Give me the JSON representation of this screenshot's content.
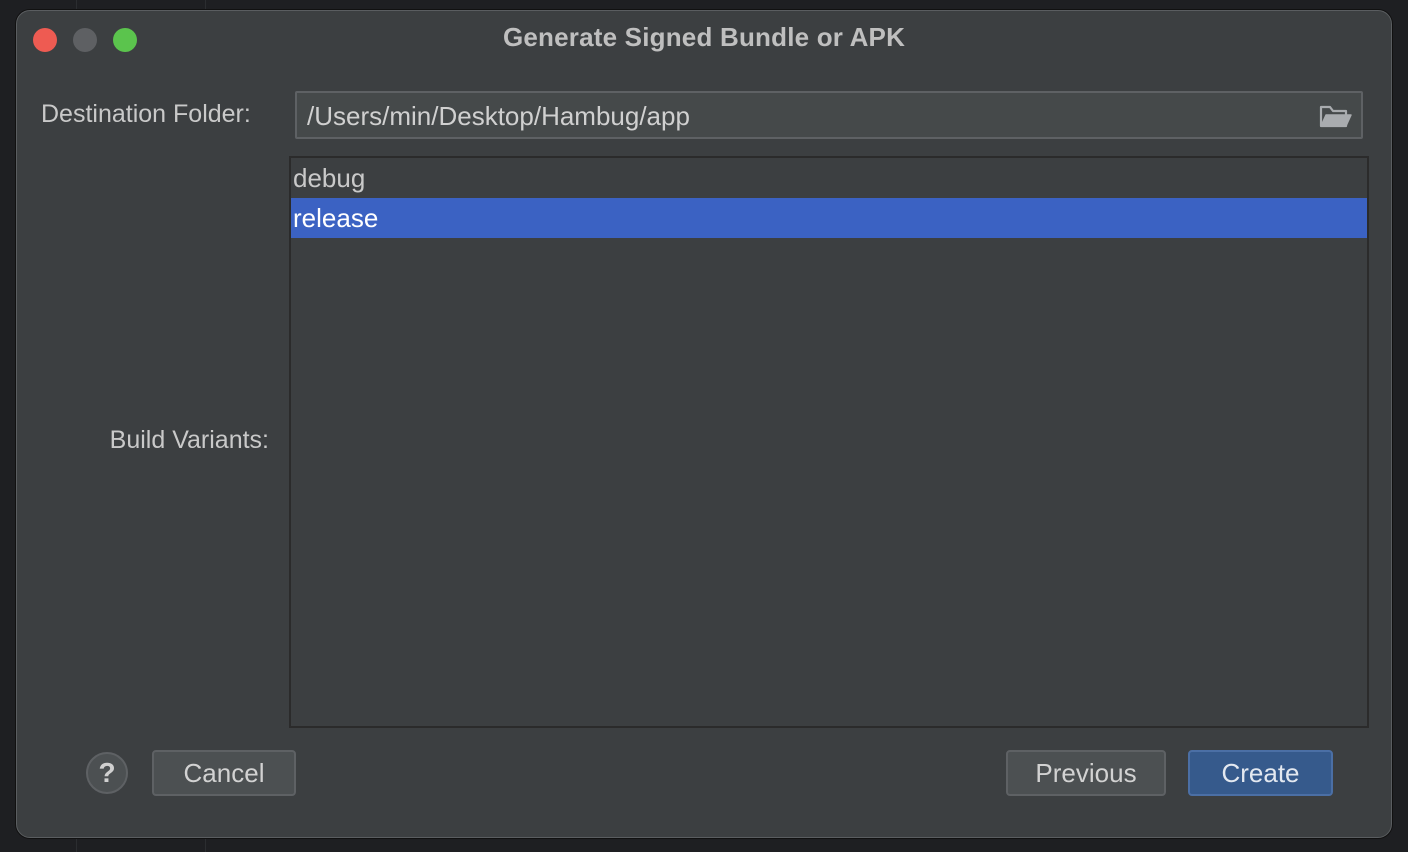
{
  "dialog": {
    "title": "Generate Signed Bundle or APK"
  },
  "destination": {
    "label": "Destination Folder:",
    "value": "/Users/min/Desktop/Hambug/app",
    "browse_icon": "folder-open-icon"
  },
  "build_variants": {
    "label": "Build Variants:",
    "items": [
      {
        "label": "debug",
        "selected": false
      },
      {
        "label": "release",
        "selected": true
      }
    ]
  },
  "footer": {
    "help_label": "?",
    "cancel_label": "Cancel",
    "previous_label": "Previous",
    "create_label": "Create"
  },
  "colors": {
    "selection": "#3b62c3",
    "dialog_bg": "#3c3f41",
    "default_button": "#365a8c"
  }
}
